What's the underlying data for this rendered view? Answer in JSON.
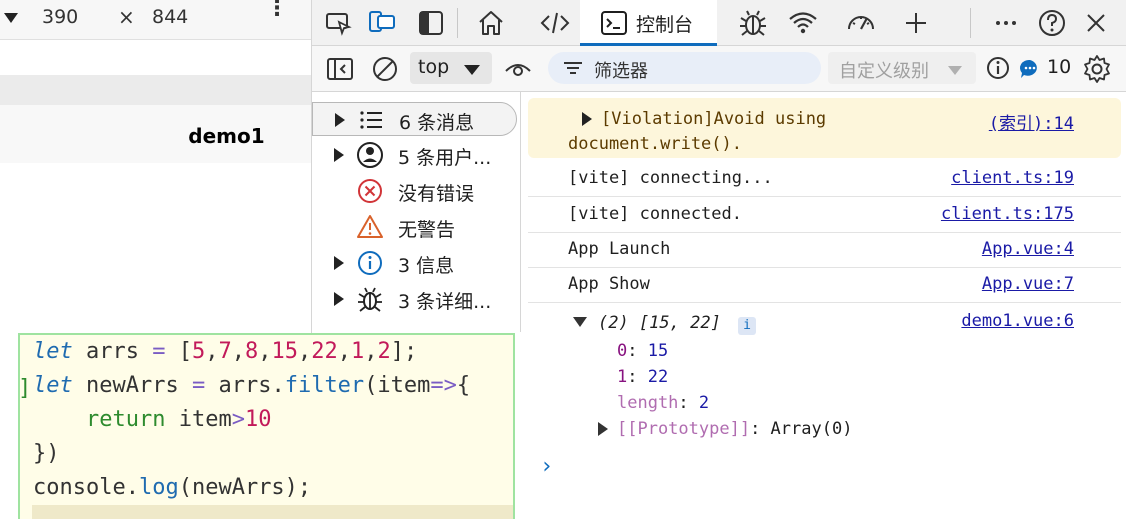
{
  "device_toolbar": {
    "width": "390",
    "times": "×",
    "height": "844",
    "more": "⋮"
  },
  "app": {
    "title": "demo1"
  },
  "devtools": {
    "tabs": {
      "console_label": "控制台"
    },
    "filter_bar": {
      "context": "top",
      "filter_placeholder": "筛选器",
      "level": "自定义级别",
      "issues_count": "10"
    },
    "sidebar": {
      "items": [
        {
          "label": "6 条消息",
          "icon": "list-icon",
          "expandable": true,
          "selected": true
        },
        {
          "label": "5 条用户...",
          "icon": "user-icon",
          "expandable": true,
          "selected": false
        },
        {
          "label": "没有错误",
          "icon": "error-icon",
          "expandable": false,
          "selected": false
        },
        {
          "label": "无警告",
          "icon": "warning-icon",
          "expandable": false,
          "selected": false
        },
        {
          "label": "3 信息",
          "icon": "info-icon",
          "expandable": true,
          "selected": false
        },
        {
          "label": "3 条详细...",
          "icon": "bug-icon",
          "expandable": true,
          "selected": false
        }
      ]
    },
    "console": {
      "violation": {
        "line1": "[Violation]Avoid using",
        "line2": "document.write().",
        "source": "(索引):14"
      },
      "messages": [
        {
          "text": "[vite] connecting...",
          "source": "client.ts:19"
        },
        {
          "text": "[vite] connected.",
          "source": "client.ts:175"
        },
        {
          "text": "App Launch",
          "source": "App.vue:4"
        },
        {
          "text": "App Show",
          "source": "App.vue:7"
        }
      ],
      "array_log": {
        "summary": "(2) [15, 22]",
        "badge": "i",
        "source": "demo1.vue:6",
        "entries": [
          {
            "key": "0",
            "value": "15"
          },
          {
            "key": "1",
            "value": "22"
          },
          {
            "key": "length",
            "value": "2"
          }
        ],
        "prototype_key": "[[Prototype]]",
        "prototype_value": "Array(0)"
      },
      "prompt": "›"
    }
  },
  "code_snippet": {
    "gutter_mark": "]",
    "lines": [
      "let arrs = [5,7,8,15,22,1,2];",
      "let newArrs = arrs.filter(item=>{",
      "    return item>10",
      "})",
      "console.log(newArrs);"
    ]
  },
  "colors": {
    "accent": "#0f6cbd",
    "violation_bg": "#fdf6db",
    "code_bg": "#fffde8",
    "code_border": "#9fe3a0"
  }
}
